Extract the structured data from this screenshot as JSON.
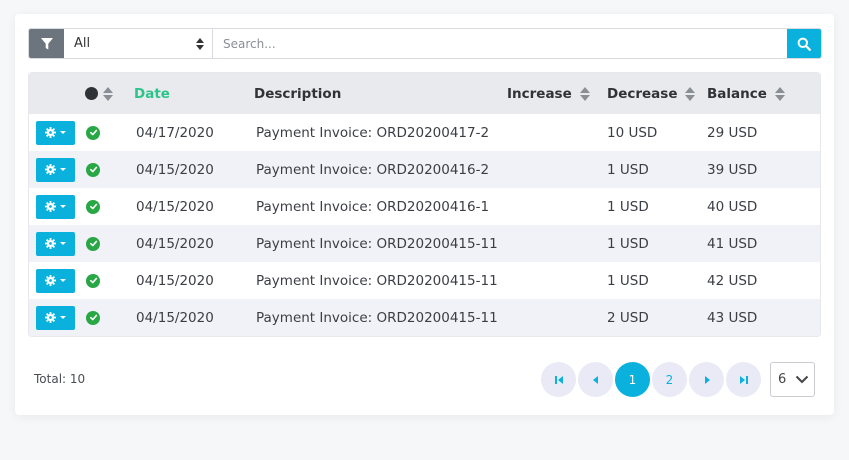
{
  "filter": {
    "select_value": "All",
    "search_placeholder": "Search..."
  },
  "table": {
    "headers": {
      "date": "Date",
      "description": "Description",
      "increase": "Increase",
      "decrease": "Decrease",
      "balance": "Balance"
    },
    "rows": [
      {
        "date": "04/17/2020",
        "description": "Payment Invoice: ORD20200417-2",
        "increase": "",
        "decrease": "10 USD",
        "balance": "29 USD"
      },
      {
        "date": "04/15/2020",
        "description": "Payment Invoice: ORD20200416-2",
        "increase": "",
        "decrease": "1 USD",
        "balance": "39 USD"
      },
      {
        "date": "04/15/2020",
        "description": "Payment Invoice: ORD20200416-1",
        "increase": "",
        "decrease": "1 USD",
        "balance": "40 USD"
      },
      {
        "date": "04/15/2020",
        "description": "Payment Invoice: ORD20200415-11",
        "increase": "",
        "decrease": "1 USD",
        "balance": "41 USD"
      },
      {
        "date": "04/15/2020",
        "description": "Payment Invoice: ORD20200415-11",
        "increase": "",
        "decrease": "1 USD",
        "balance": "42 USD"
      },
      {
        "date": "04/15/2020",
        "description": "Payment Invoice: ORD20200415-11",
        "increase": "",
        "decrease": "2 USD",
        "balance": "43 USD"
      }
    ]
  },
  "footer": {
    "total_label": "Total: 10",
    "pages": [
      "1",
      "2"
    ],
    "current_page": "1",
    "per_page": "6"
  },
  "colors": {
    "accent": "#0ab1dd",
    "active_sort": "#2bc48a",
    "status_ok": "#28a745",
    "filter_button": "#6c757d"
  },
  "icons": {
    "filter": "filter-icon",
    "search": "search-icon",
    "row_action": "gear-icon",
    "status": "check-circle-icon",
    "first": "first-page-icon",
    "prev": "prev-page-icon",
    "next": "next-page-icon",
    "last": "last-page-icon",
    "dropdown": "chevron-down-icon"
  }
}
